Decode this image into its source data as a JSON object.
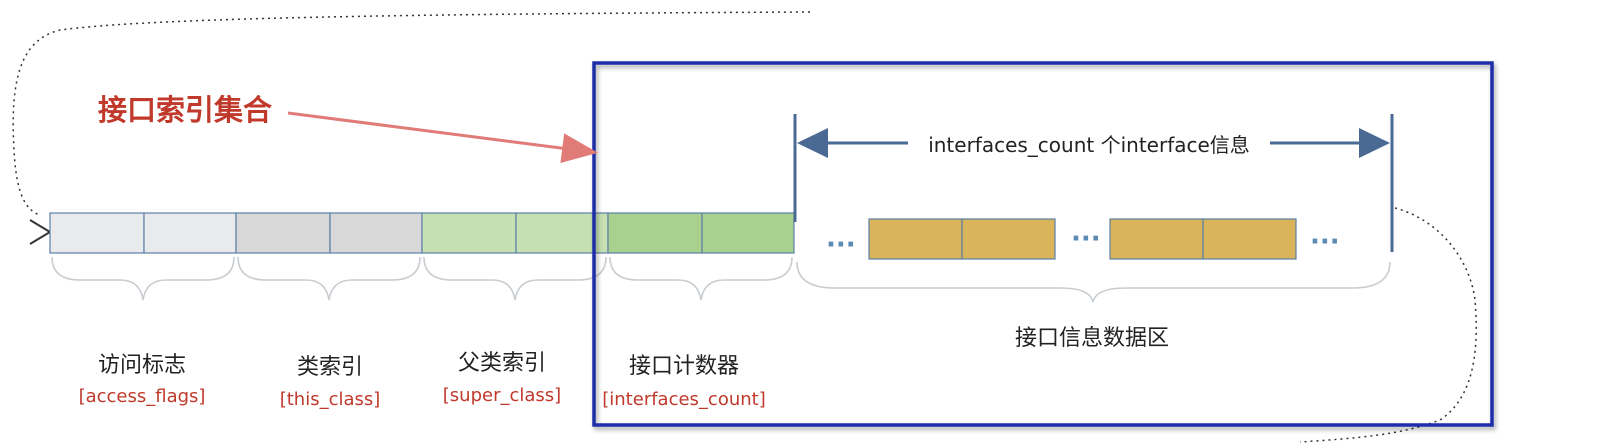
{
  "callout": {
    "text": "接口索引集合",
    "color": "#c0392b"
  },
  "range_label": "interfaces_count 个interface信息",
  "ellipsis": "···",
  "fields": [
    {
      "name_cn": "访问标志",
      "name_en": "[access_flags]"
    },
    {
      "name_cn": "类索引",
      "name_en": "[this_class]"
    },
    {
      "name_cn": "父类索引",
      "name_en": "[super_class]"
    },
    {
      "name_cn": "接口计数器",
      "name_en": "[interfaces_count]"
    }
  ],
  "data_area_label": "接口信息数据区",
  "colors": {
    "access_flags": "#e8eaec",
    "this_class": "#d8d8d8",
    "super_class": "#c6e0b4",
    "interfaces_count": "#a9d08e",
    "interface_info": "#d9b45a",
    "highlight_box": "#1f2fa8",
    "field_en": "#c0392b",
    "cell_border": "#5b7fa6",
    "arrow": "#4a6a94",
    "dots": "#5b8bb5"
  }
}
